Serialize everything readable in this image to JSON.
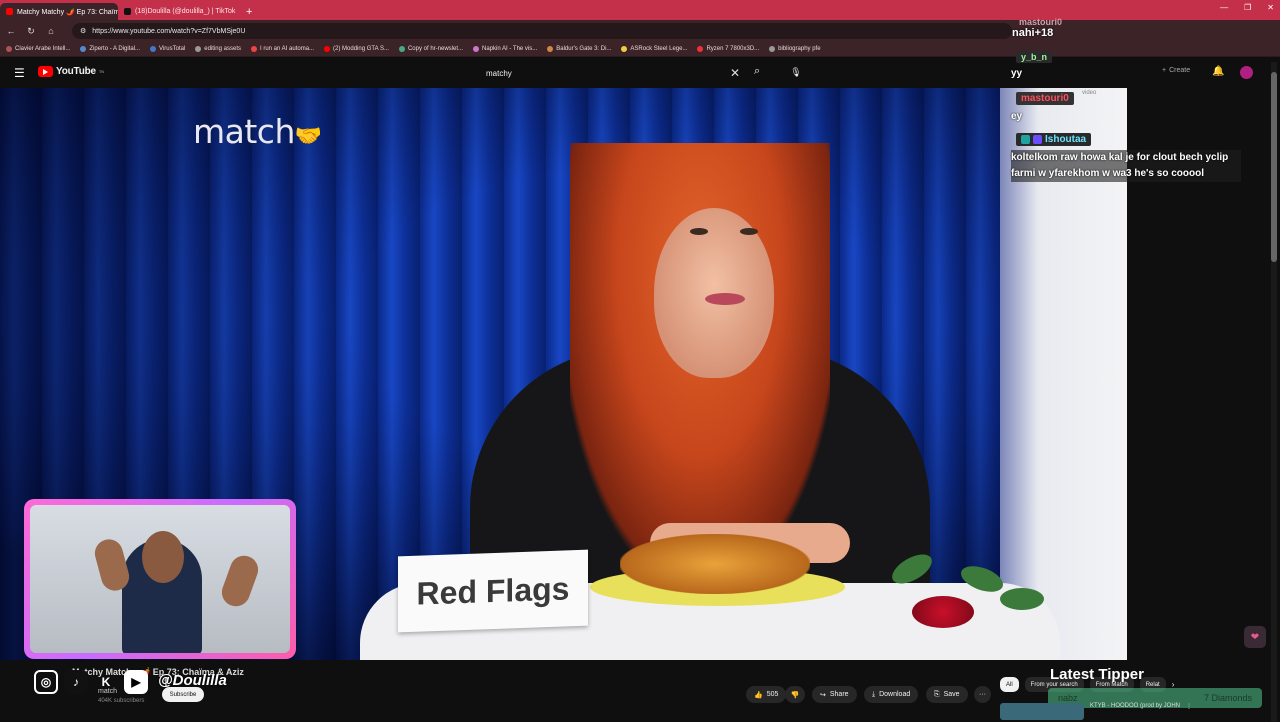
{
  "browser": {
    "tabs": [
      {
        "label": "Matchy Matchy 🌶️ Ep 73: Chaïma",
        "active": true
      },
      {
        "label": "(18)Doulilla (@doulilla_) | TikTok",
        "active": false
      }
    ],
    "new_tab": "+",
    "url": "https://www.youtube.com/watch?v=Zf7VbMSje0U",
    "bookmarks": [
      "Clavier Arabe Intell...",
      "Ziperto - A Digital...",
      "VirusTotal",
      "editing assets",
      "I run an AI automa...",
      "(2) Modding GTA S...",
      "Copy of hr-newslet...",
      "Napkin AI - The vis...",
      "Baldur's Gate 3: Di...",
      "ASRock Steel Lege...",
      "Ryzen 7 7800x3D...",
      "bibliography pfe"
    ]
  },
  "youtube": {
    "logo": "YouTube",
    "logo_sup": "TN",
    "search_value": "matchy",
    "create_label": "Create"
  },
  "video": {
    "brand_logo": "match",
    "placard_text": "Red Flags",
    "badge": "video"
  },
  "chat": [
    {
      "name": "mastouri0",
      "msg": "nahi+18"
    },
    {
      "name": "y_b_n",
      "msg": "yy"
    },
    {
      "name": "mastouri0",
      "msg": "ey"
    },
    {
      "name": "Ishoutaa",
      "msg": "koltelkom raw howa kal je for clout bech yclip farmi w yfarekhom w wa3 he's so cooool"
    }
  ],
  "below": {
    "title": "Matchy Matchy 🌶️ Ep 73: Chaïma & Aziz",
    "handle": "@Doulilla",
    "channel": "match",
    "subscribers": "404K subscribers",
    "subscribe_label": "Subscribe",
    "likes": "505",
    "share_label": "Share",
    "download_label": "Download",
    "save_label": "Save",
    "more_label": "···",
    "latest_tipper_label": "Latest Tipper",
    "tipper_name": "nabz",
    "tipper_amount": "7 Diamonds",
    "chips": [
      "All",
      "From your search",
      "From Match",
      "Relat"
    ],
    "rec_title": "KTYB - HOODOO (prod by JOHN"
  },
  "colors": {
    "tabbar": "#c4304a",
    "chrome": "#3c2328",
    "yt_red": "#ff0000",
    "cam_border": "#ff6ad5"
  }
}
